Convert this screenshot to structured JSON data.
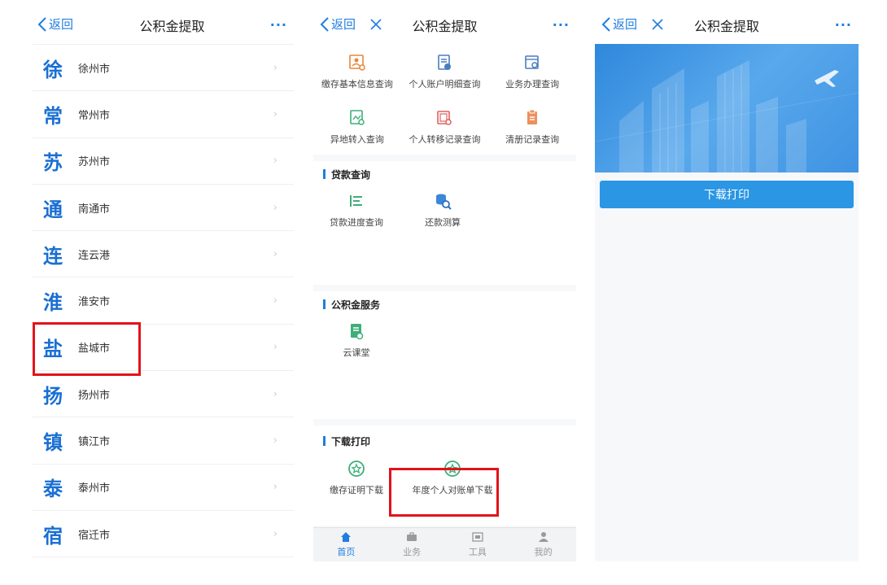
{
  "colors": {
    "accent": "#1f7ee0",
    "highlight": "#e2131a",
    "city_glyph": "#1a6fd3",
    "button": "#2a96e4"
  },
  "panel1": {
    "nav": {
      "back": "返回",
      "title": "公积金提取",
      "more": "···"
    },
    "cities": [
      {
        "glyph": "徐",
        "name": "徐州市"
      },
      {
        "glyph": "常",
        "name": "常州市"
      },
      {
        "glyph": "苏",
        "name": "苏州市"
      },
      {
        "glyph": "通",
        "name": "南通市"
      },
      {
        "glyph": "连",
        "name": "连云港"
      },
      {
        "glyph": "淮",
        "name": "淮安市"
      },
      {
        "glyph": "盐",
        "name": "盐城市"
      },
      {
        "glyph": "扬",
        "name": "扬州市"
      },
      {
        "glyph": "镇",
        "name": "镇江市"
      },
      {
        "glyph": "泰",
        "name": "泰州市"
      },
      {
        "glyph": "宿",
        "name": "宿迁市"
      }
    ],
    "chevron": "›"
  },
  "panel2": {
    "nav": {
      "back": "返回",
      "title": "公积金提取",
      "more": "···"
    },
    "query_items": [
      {
        "label": "缴存基本信息查询",
        "icon": "id-card-search-icon"
      },
      {
        "label": "个人账户明细查询",
        "icon": "account-detail-icon"
      },
      {
        "label": "业务办理查询",
        "icon": "business-search-icon"
      },
      {
        "label": "异地转入查询",
        "icon": "transfer-in-icon"
      },
      {
        "label": "个人转移记录查询",
        "icon": "transfer-record-icon"
      },
      {
        "label": "清册记录查询",
        "icon": "roster-record-icon"
      }
    ],
    "loan": {
      "title": "贷款查询",
      "items": [
        {
          "label": "贷款进度查询",
          "icon": "progress-list-icon"
        },
        {
          "label": "还款测算",
          "icon": "repay-calc-icon"
        }
      ]
    },
    "service": {
      "title": "公积金服务",
      "items": [
        {
          "label": "云课堂",
          "icon": "cloud-class-icon"
        }
      ]
    },
    "download": {
      "title": "下载打印",
      "items": [
        {
          "label": "缴存证明下载",
          "icon": "star-badge-icon"
        },
        {
          "label": "年度个人对账单下载",
          "icon": "star-badge-icon"
        }
      ]
    },
    "tabs": [
      {
        "label": "首页",
        "icon": "home-icon",
        "active": true
      },
      {
        "label": "业务",
        "icon": "briefcase-icon",
        "active": false
      },
      {
        "label": "工具",
        "icon": "tools-icon",
        "active": false
      },
      {
        "label": "我的",
        "icon": "user-icon",
        "active": false
      }
    ]
  },
  "panel3": {
    "nav": {
      "back": "返回",
      "title": "公积金提取",
      "more": "···"
    },
    "print_button": "下载打印"
  }
}
